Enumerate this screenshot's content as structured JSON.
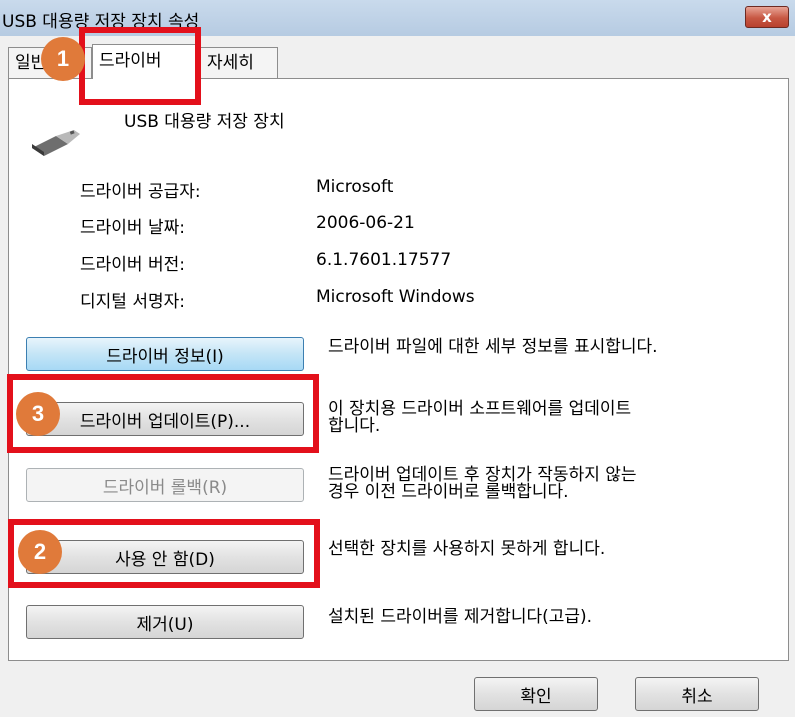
{
  "window": {
    "title": "USB 대용량 저장 장치 속성",
    "close_label": "x"
  },
  "tabs": [
    {
      "label": "일반"
    },
    {
      "label": "드라이버"
    },
    {
      "label": "자세히"
    }
  ],
  "device": {
    "name": "USB 대용량 저장 장치",
    "icon": "usb-icon"
  },
  "driver_info": [
    {
      "label": "드라이버 공급자:",
      "value": "Microsoft"
    },
    {
      "label": "드라이버 날짜:",
      "value": "2006-06-21"
    },
    {
      "label": "드라이버 버전:",
      "value": "6.1.7601.17577"
    },
    {
      "label": "디지털 서명자:",
      "value": "Microsoft Windows"
    }
  ],
  "actions": [
    {
      "label": "드라이버 정보(I)",
      "desc_lines": [
        "드라이버 파일에 대한 세부 정보를 표시합니다."
      ]
    },
    {
      "label": "드라이버 업데이트(P)...",
      "desc_lines": [
        "이 장치용 드라이버 소프트웨어를 업데이트",
        "합니다."
      ]
    },
    {
      "label": "드라이버 롤백(R)",
      "desc_lines": [
        "드라이버 업데이트 후 장치가 작동하지 않는",
        "경우 이전 드라이버로 롤백합니다."
      ]
    },
    {
      "label": "사용 안 함(D)",
      "desc_lines": [
        "선택한 장치를 사용하지 못하게 합니다."
      ]
    },
    {
      "label": "제거(U)",
      "desc_lines": [
        "설치된 드라이버를 제거합니다(고급)."
      ]
    }
  ],
  "footer": {
    "ok_label": "확인",
    "cancel_label": "취소"
  },
  "callouts": [
    "1",
    "2",
    "3"
  ],
  "colors": {
    "callout_border": "#e3101b",
    "callout_badge": "#e07a3a"
  }
}
